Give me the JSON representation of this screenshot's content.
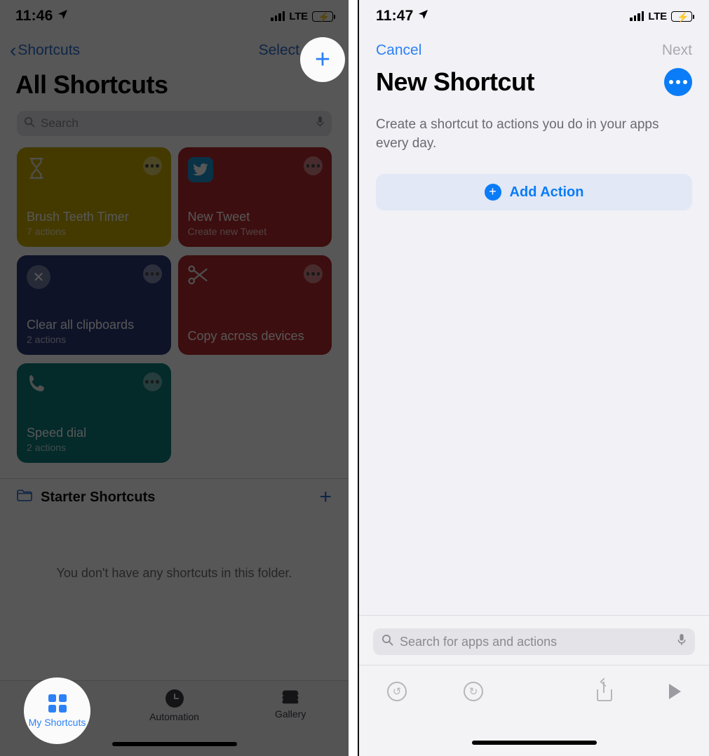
{
  "left_phone": {
    "status_bar": {
      "time": "11:46",
      "location_icon": "location-arrow-icon",
      "carrier": "LTE",
      "signal_icon": "signal-bars-icon",
      "battery_icon": "battery-charging-icon"
    },
    "nav": {
      "back_label": "Shortcuts",
      "back_icon": "chevron-left-icon",
      "select_label": "Select",
      "add_label": "+",
      "add_icon": "plus-icon"
    },
    "page_title": "All Shortcuts",
    "search": {
      "placeholder": "Search",
      "icon": "search-icon",
      "mic_icon": "microphone-icon"
    },
    "shortcuts": [
      {
        "title": "Brush Teeth Timer",
        "subtitle": "7 actions",
        "color": "#c7a900",
        "icon": "hourglass-icon",
        "glyph": "⌛",
        "menu_icon": "more-options-icon"
      },
      {
        "title": "New Tweet",
        "subtitle": "Create new Tweet",
        "color": "#b4292c",
        "icon": "twitter-icon",
        "glyph": "🐦",
        "menu_icon": "more-options-icon"
      },
      {
        "title": "Clear all clipboards",
        "subtitle": "2 actions",
        "color": "#2a3a76",
        "icon": "x-circle-icon",
        "glyph": "✕",
        "menu_icon": "more-options-icon"
      },
      {
        "title": "Copy across devices",
        "subtitle": "",
        "color": "#b4292c",
        "icon": "scissors-icon",
        "glyph": "✂",
        "menu_icon": "more-options-icon"
      },
      {
        "title": "Speed dial",
        "subtitle": "2 actions",
        "color": "#0c7c7c",
        "icon": "phone-icon",
        "glyph": "📞",
        "menu_icon": "more-options-icon"
      }
    ],
    "folder": {
      "icon": "folder-icon",
      "label": "Starter Shortcuts",
      "add_icon": "plus-icon",
      "empty_text": "You don't have any shortcuts in this folder."
    },
    "tabs": [
      {
        "label": "My Shortcuts",
        "icon": "grid-icon",
        "active": true
      },
      {
        "label": "Automation",
        "icon": "clock-icon",
        "active": false
      },
      {
        "label": "Gallery",
        "icon": "layers-icon",
        "active": false
      }
    ],
    "highlight": {
      "plus_button": "plus-icon",
      "tab": "My Shortcuts"
    }
  },
  "right_phone": {
    "status_bar": {
      "time": "11:47",
      "location_icon": "location-arrow-icon",
      "carrier": "LTE",
      "signal_icon": "signal-bars-icon",
      "battery_icon": "battery-charging-icon"
    },
    "nav": {
      "cancel_label": "Cancel",
      "next_label": "Next"
    },
    "page_title": "New Shortcut",
    "more_button_icon": "more-options-icon",
    "description": "Create a shortcut to actions you do in your apps every day.",
    "add_action": {
      "label": "Add Action",
      "icon": "plus-circle-icon",
      "plus": "+"
    },
    "search": {
      "placeholder": "Search for apps and actions",
      "icon": "search-icon",
      "mic_icon": "microphone-icon"
    },
    "toolbar": [
      {
        "name": "undo",
        "icon": "undo-icon",
        "glyph": "↶"
      },
      {
        "name": "redo",
        "icon": "redo-icon",
        "glyph": "↷"
      },
      {
        "name": "share",
        "icon": "share-icon"
      },
      {
        "name": "run",
        "icon": "play-icon"
      }
    ]
  },
  "colors": {
    "accent_blue": "#0a7cf7",
    "nav_blue": "#2d81f7",
    "dim_overlay": "rgba(0,0,0,0.66)",
    "spotlight": "#fbfbfb"
  }
}
